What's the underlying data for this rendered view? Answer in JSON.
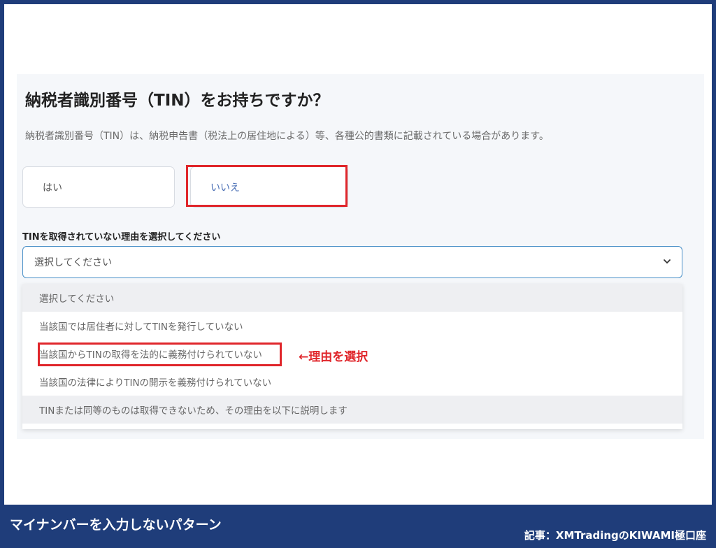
{
  "question": {
    "title": "納税者識別番号（TIN）をお持ちですか？",
    "description": "納税者識別番号（TIN）は、納税申告書（税法上の居住地による）等、各種公的書類に記載されている場合があります。"
  },
  "options": {
    "yes_label": "はい",
    "no_label": "いいえ"
  },
  "reason_select": {
    "label": "TINを取得されていない理由を選択してください",
    "value": "選択してください",
    "items": [
      "選択してください",
      "当該国では居住者に対してTINを発行していない",
      "当該国からTINの取得を法的に義務付けられていない",
      "当該国の法律によりTINの開示を義務付けられていない",
      "TINまたは同等のものは取得できないため、その理由を以下に説明します"
    ]
  },
  "annotation": {
    "text": "←理由を選択"
  },
  "caption": {
    "main": "マイナンバーを入力しないパターン",
    "credit": "記事：XMTradingのKIWAMI極口座"
  },
  "colors": {
    "frame": "#1f3d7a",
    "highlight": "#e0262b",
    "select_border": "#4a90c8"
  }
}
